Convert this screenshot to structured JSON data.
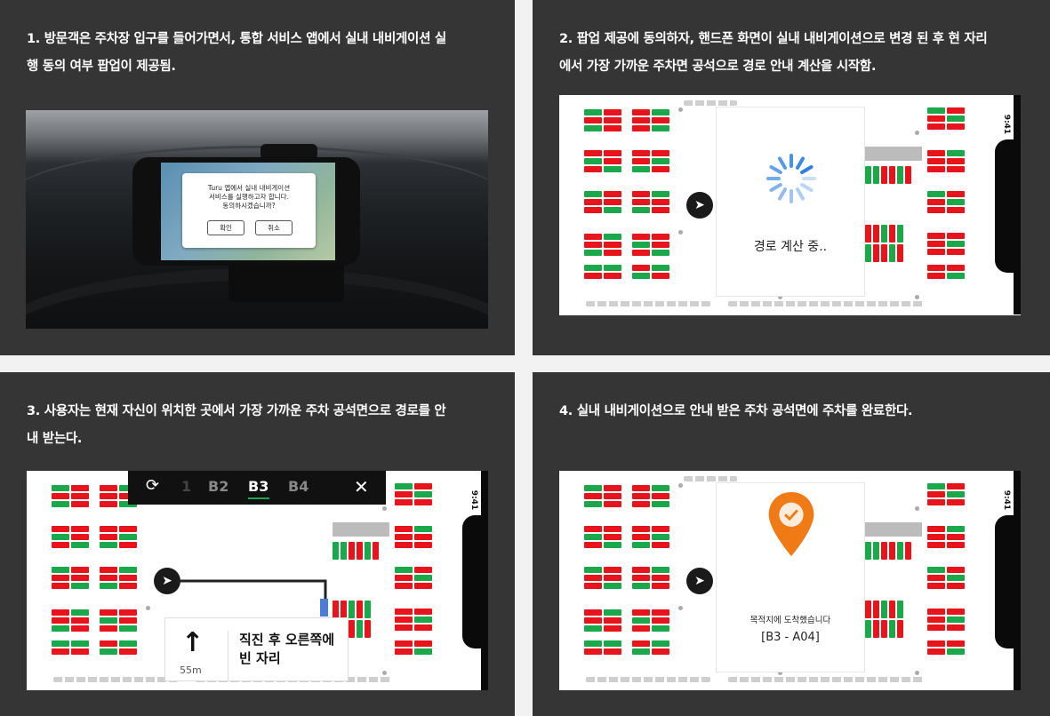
{
  "panels": [
    {
      "caption": "1. 방문객은 주차장 입구를 들어가면서, 통합 서비스 앱에서 실내 내비게이션 실\n행 동의 여부 팝업이 제공됨."
    },
    {
      "caption": "2. 팝업 제공에 동의하자, 핸드폰 화면이 실내 내비게이션으로 변경 된 후 현 자리\n에서 가장 가까운 주차면 공석으로 경로 안내 계산을 시작함."
    },
    {
      "caption": "3. 사용자는 현재 자신이 위치한 곳에서 가장 가까운 주차 공석면으로 경로를 안\n내 받는다."
    },
    {
      "caption": "4. 실내 내비게이션으로 안내 받은 주차 공석면에 주차를 완료한다."
    }
  ],
  "popup": {
    "message": "Turu 앱에서 실내 내비게이션\n서비스를 실행하고자 합니다.\n동의하시겠습니까?",
    "confirm": "확인",
    "cancel": "취소"
  },
  "status_time": "9:41",
  "calculating_text": "경로 계산 중..",
  "floor_bar": {
    "floors": [
      "1",
      "B2",
      "B3",
      "B4"
    ],
    "active": "B3"
  },
  "guidance": {
    "arrow": "↑",
    "distance": "55m",
    "instruction": "직진 후 오른쪽에\n빈 자리"
  },
  "arrival": {
    "message": "목적지에 도착했습니다",
    "spot": "[B3 - A04]"
  },
  "colors": {
    "occupied": "#e8141b",
    "available": "#1aa84a",
    "active_floor_underline": "#1aa84a",
    "route": "#222222",
    "target_spot": "#4a7cd8",
    "pin": "#f07a16"
  }
}
